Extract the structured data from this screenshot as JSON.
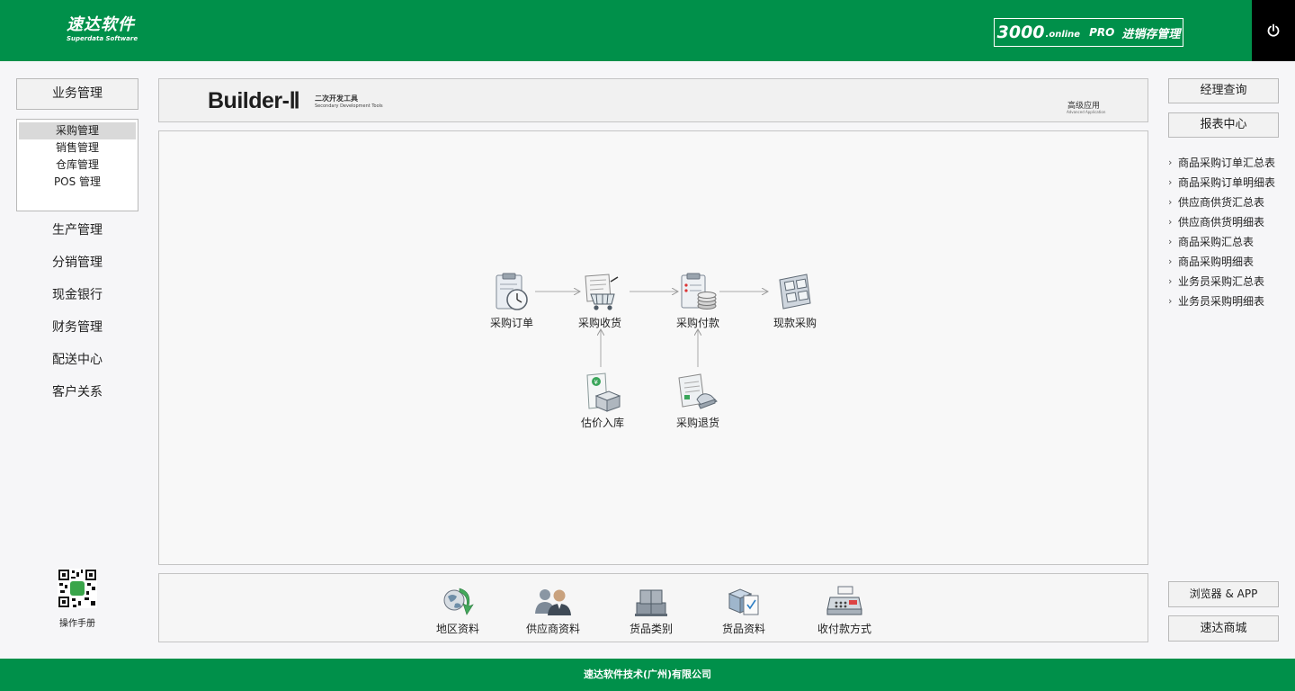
{
  "header": {
    "logo_cn": "速达软件",
    "logo_en": "Superdata Software",
    "product_num": "3000",
    "product_online": ".online",
    "product_pro": "PRO",
    "product_name": "进销存管理",
    "power_icon": "power-icon"
  },
  "left_sidebar": {
    "business_button": "业务管理",
    "submenu": [
      {
        "label": "采购管理",
        "active": true
      },
      {
        "label": "销售管理",
        "active": false
      },
      {
        "label": "仓库管理",
        "active": false
      },
      {
        "label": "POS 管理",
        "active": false
      }
    ],
    "modules": [
      "生产管理",
      "分销管理",
      "现金银行",
      "财务管理",
      "配送中心",
      "客户关系"
    ],
    "manual_label": "操作手册",
    "qr_icon": "qr-code-icon"
  },
  "banner": {
    "title": "Builder-Ⅱ",
    "subtitle_cn": "二次开发工具",
    "subtitle_en": "Secondary Development Tools",
    "advanced_cn": "高级应用",
    "advanced_en": "Advanced Application"
  },
  "workflow": {
    "nodes": {
      "purchase_order": "采购订单",
      "purchase_receive": "采购收货",
      "purchase_payment": "采购付款",
      "cash_purchase": "现款采购",
      "estimate_stock_in": "估价入库",
      "purchase_return": "采购退货"
    }
  },
  "bottom_toolbar": {
    "items": [
      "地区资料",
      "供应商资料",
      "货品类别",
      "货品资料",
      "收付款方式"
    ]
  },
  "right_sidebar": {
    "manager_query": "经理查询",
    "report_center": "报表中心",
    "reports": [
      "商品采购订单汇总表",
      "商品采购订单明细表",
      "供应商供货汇总表",
      "供应商供货明细表",
      "商品采购汇总表",
      "商品采购明细表",
      "业务员采购汇总表",
      "业务员采购明细表"
    ],
    "browser_app": "浏览器 & APP",
    "mall": "速达商城"
  },
  "footer": {
    "company": "速达软件技术(广州)有限公司"
  },
  "colors": {
    "brand_green": "#00904a",
    "power_bg": "#000000"
  }
}
